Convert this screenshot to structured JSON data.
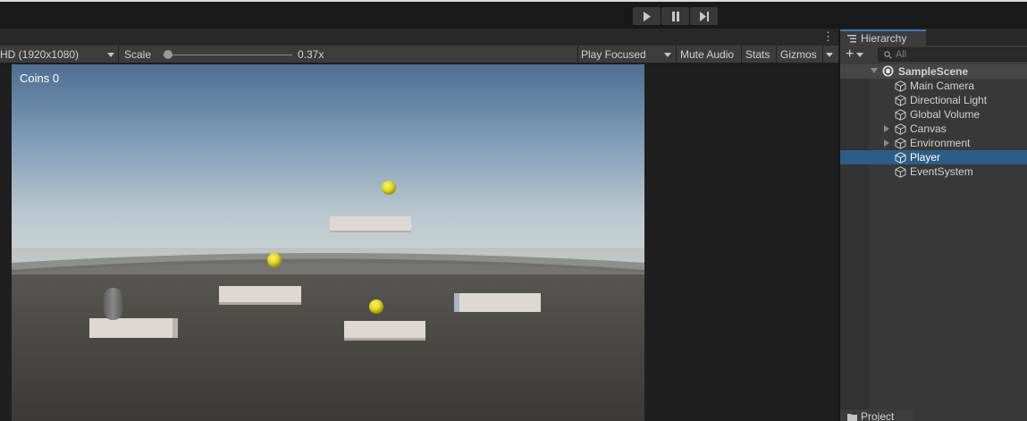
{
  "toolbar": {
    "play_icon": "play-icon",
    "pause_icon": "pause-icon",
    "step_icon": "step-icon"
  },
  "game_view": {
    "resolution": "HD (1920x1080)",
    "scale_label": "Scale",
    "scale_value": "0.37x",
    "scale_fraction": 0.04,
    "play_mode": "Play Focused",
    "mute_audio": "Mute Audio",
    "stats": "Stats",
    "gizmos": "Gizmos",
    "coins_text": "Coins 0"
  },
  "hierarchy": {
    "tab_label": "Hierarchy",
    "search_placeholder": "All",
    "scene": "SampleScene",
    "items": [
      {
        "label": "Main Camera",
        "expandable": false,
        "selected": false
      },
      {
        "label": "Directional Light",
        "expandable": false,
        "selected": false
      },
      {
        "label": "Global Volume",
        "expandable": false,
        "selected": false
      },
      {
        "label": "Canvas",
        "expandable": true,
        "selected": false
      },
      {
        "label": "Environment",
        "expandable": true,
        "selected": false
      },
      {
        "label": "Player",
        "expandable": false,
        "selected": true
      },
      {
        "label": "EventSystem",
        "expandable": false,
        "selected": false
      }
    ]
  },
  "project": {
    "tab_label": "Project"
  },
  "colors": {
    "selection": "#2c5d87",
    "accent": "#3a79bb",
    "coin": "#e3d61f"
  }
}
